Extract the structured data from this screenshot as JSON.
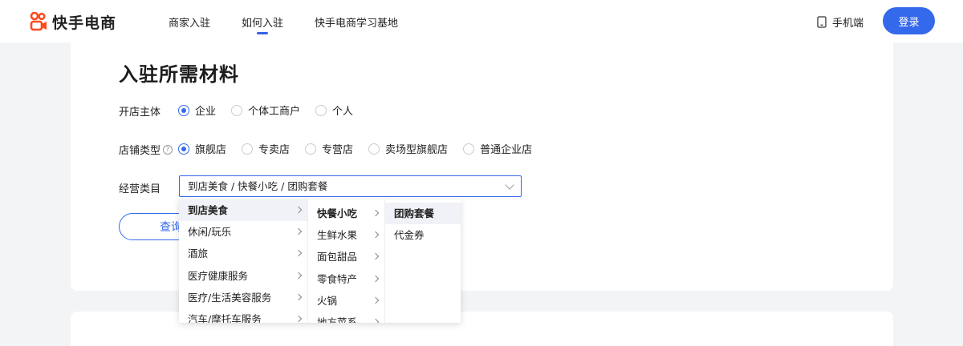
{
  "header": {
    "logo_text": "快手电商",
    "nav": [
      "商家入驻",
      "如何入驻",
      "快手电商学习基地"
    ],
    "mobile_label": "手机端",
    "login_label": "登录"
  },
  "section": {
    "title": "入驻所需材料"
  },
  "form": {
    "subject_label": "开店主体",
    "subject_options": [
      "企业",
      "个体工商户",
      "个人"
    ],
    "store_type_label": "店铺类型",
    "store_type_options": [
      "旗舰店",
      "专卖店",
      "专营店",
      "卖场型旗舰店",
      "普通企业店"
    ],
    "category_label": "经营类目",
    "category_value": "到店美食 / 快餐小吃 / 团购套餐",
    "query_label": "查询"
  },
  "cascader": {
    "col1": [
      "到店美食",
      "休闲/玩乐",
      "酒旅",
      "医疗健康服务",
      "医疗/生活美容服务",
      "汽车/摩托车服务"
    ],
    "col2": [
      "快餐小吃",
      "生鲜水果",
      "面包甜品",
      "零食特产",
      "火锅",
      "地方菜系"
    ],
    "col3": [
      "团购套餐",
      "代金券"
    ]
  },
  "colors": {
    "accent": "#3569ec",
    "logo": "#fe4a1e"
  }
}
